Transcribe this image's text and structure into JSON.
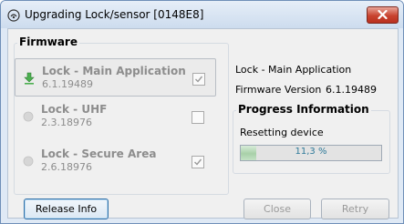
{
  "window": {
    "title": "Upgrading Lock/sensor [0148E8]",
    "title_icon": "radio-wave-icon",
    "close_icon": "close-icon"
  },
  "firmware": {
    "legend": "Firmware",
    "items": [
      {
        "name": "Lock - Main Application",
        "version": "6.1.19489",
        "status_icon": "download-arrow-icon",
        "checked": true,
        "selected": true
      },
      {
        "name": "Lock - UHF",
        "version": "2.3.18976",
        "status_icon": "idle-dot-icon",
        "checked": false,
        "selected": false
      },
      {
        "name": "Lock - Secure Area",
        "version": "2.6.18976",
        "status_icon": "idle-dot-icon",
        "checked": true,
        "selected": false
      }
    ]
  },
  "info": {
    "component": "Lock - Main Application",
    "firmware_version_label": "Firmware Version",
    "firmware_version": "6.1.19489"
  },
  "progress": {
    "legend": "Progress Information",
    "status": "Resetting device",
    "percent_label": "11,3 %",
    "fraction": 0.113
  },
  "buttons": {
    "release_info": "Release Info",
    "close": "Close",
    "retry": "Retry"
  },
  "colors": {
    "progress_fill": "#a8d0a8",
    "download_icon": "#4caf50",
    "close_button": "#c8432f"
  }
}
